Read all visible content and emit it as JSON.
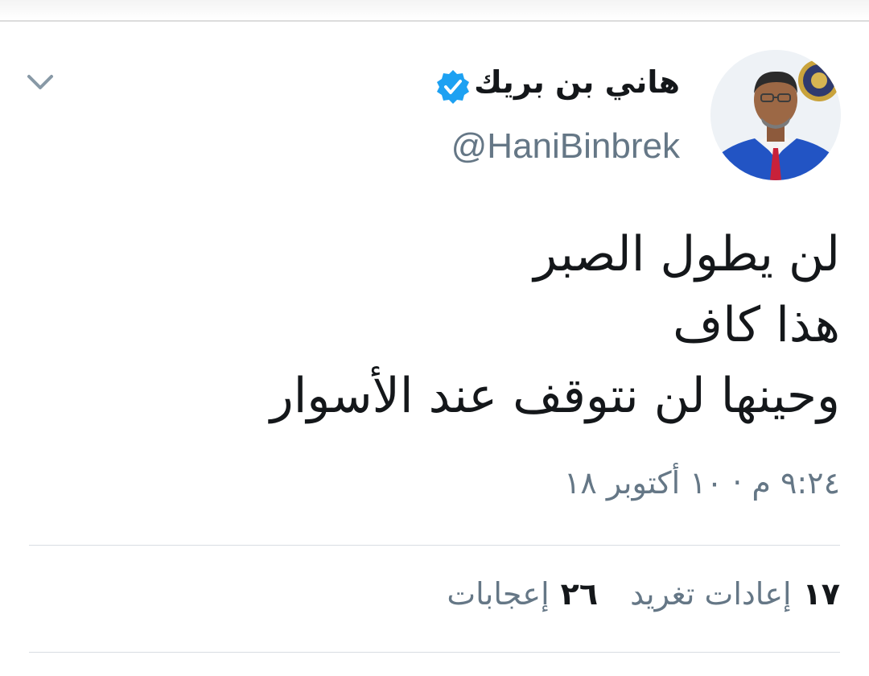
{
  "tweet": {
    "author": {
      "display_name": "هاني بن بريك",
      "handle": "@HaniBinbrek",
      "verified": true
    },
    "text_lines": [
      "لن يطول الصبر",
      "هذا كاف",
      "وحينها لن نتوقف عند الأسوار"
    ],
    "timestamp": "٩:٢٤ م · ١٠ أكتوبر ١٨",
    "stats": {
      "retweets_count": "١٧",
      "retweets_label": "إعادات تغريد",
      "likes_count": "٢٦",
      "likes_label": "إعجابات"
    }
  },
  "icons": {
    "menu": "chevron-down-icon",
    "verified": "verified-badge-icon"
  },
  "colors": {
    "text": "#14171a",
    "secondary": "#657786",
    "verified": "#1da1f2",
    "divider": "#d8dde3"
  }
}
